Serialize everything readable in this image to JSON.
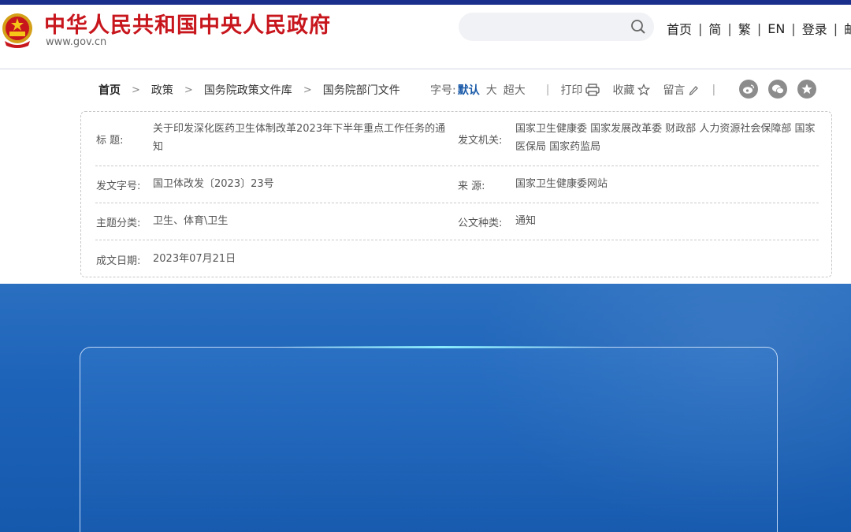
{
  "header": {
    "site_title": "中华人民共和国中央人民政府",
    "site_domain": "www.gov.cn",
    "search_placeholder": "",
    "nav": [
      {
        "label": "首页"
      },
      {
        "label": "简"
      },
      {
        "label": "繁"
      },
      {
        "label": "EN"
      },
      {
        "label": "登录"
      },
      {
        "label": "邮"
      }
    ]
  },
  "breadcrumb": {
    "items": [
      "首页",
      "政策",
      "国务院政策文件库",
      "国务院部门文件"
    ]
  },
  "tools": {
    "font_size_label": "字号:",
    "sizes": [
      "默认",
      "大",
      "超大"
    ],
    "print_label": "打印",
    "favorite_label": "收藏",
    "comment_label": "留言",
    "social_icons": [
      "weibo-icon",
      "wechat-icon",
      "favorite-star-icon"
    ]
  },
  "document_info": {
    "title_label": "标      题:",
    "title_value": "关于印发深化医药卫生体制改革2023年下半年重点工作任务的通知",
    "issuer_label": "发文机关:",
    "issuer_value": "国家卫生健康委  国家发展改革委  财政部  人力资源社会保障部  国家医保局  国家药监局",
    "doc_number_label": "发文字号:",
    "doc_number_value": "国卫体改发〔2023〕23号",
    "source_label": "来      源:",
    "source_value": "国家卫生健康委网站",
    "category_label": "主题分类:",
    "category_value": "卫生、体育\\卫生",
    "doc_type_label": "公文种类:",
    "doc_type_value": "通知",
    "date_label": "成文日期:",
    "date_value": "2023年07月21日"
  },
  "colors": {
    "brand_red": "#c8161d",
    "top_bar": "#1a2f8c",
    "accent_blue": "#1a5aa8",
    "section_blue": "#1d63b8"
  }
}
